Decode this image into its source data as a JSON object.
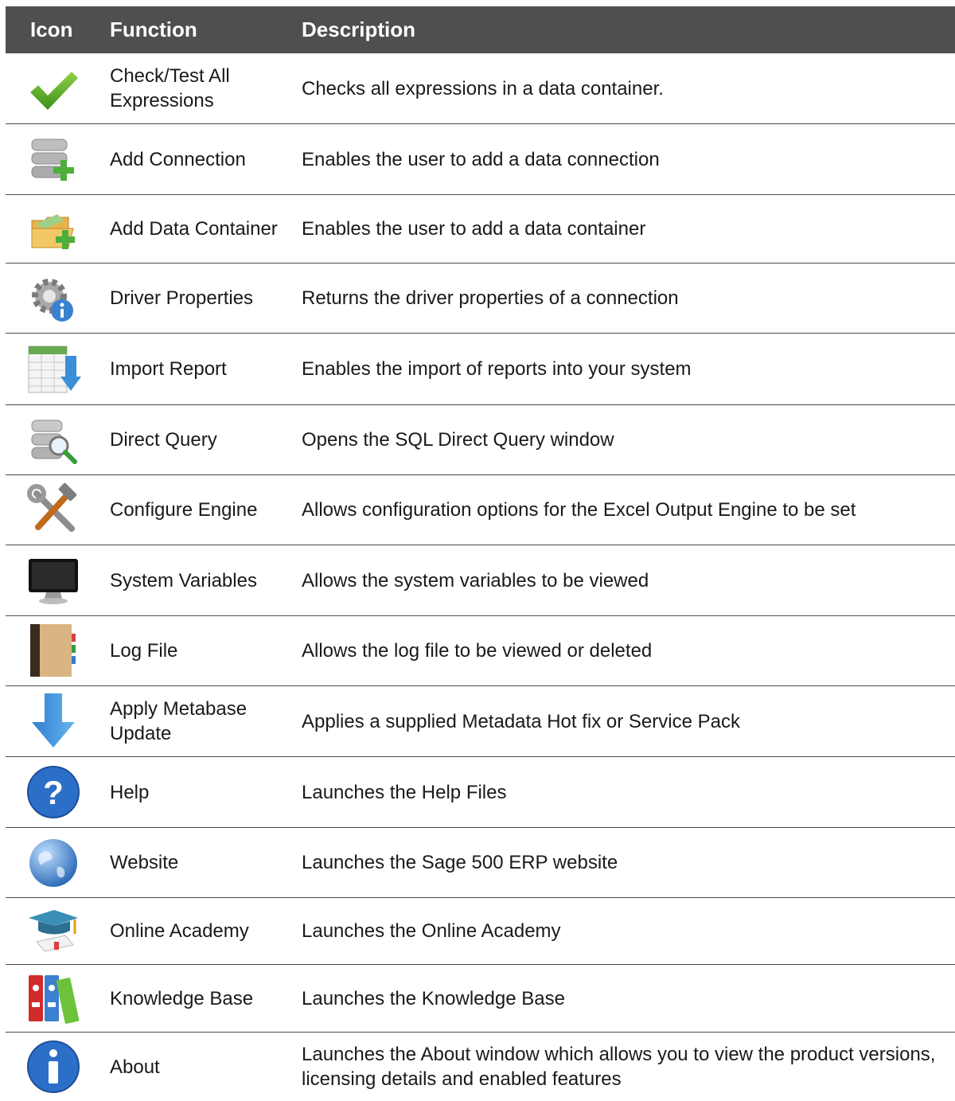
{
  "header": {
    "icon": "Icon",
    "function": "Function",
    "description": "Description"
  },
  "rows": [
    {
      "icon": "check-icon",
      "function": "Check/Test All Expressions",
      "description": "Checks all expressions in a data container."
    },
    {
      "icon": "add-connection-icon",
      "function": "Add Connection",
      "description": "Enables the user to add a data connection"
    },
    {
      "icon": "add-folder-icon",
      "function": "Add Data Container",
      "description": "Enables the user to add a data container"
    },
    {
      "icon": "gear-info-icon",
      "function": "Driver Properties",
      "description": "Returns the driver properties of a connection"
    },
    {
      "icon": "import-report-icon",
      "function": "Import Report",
      "description": "Enables the import of reports into your system"
    },
    {
      "icon": "database-search-icon",
      "function": "Direct Query",
      "description": "Opens the SQL Direct Query window"
    },
    {
      "icon": "tools-icon",
      "function": "Configure Engine",
      "description": "Allows configuration options for the Excel Output Engine to be set"
    },
    {
      "icon": "monitor-icon",
      "function": "System Variables",
      "description": "Allows the system variables to be viewed"
    },
    {
      "icon": "log-book-icon",
      "function": "Log File",
      "description": "Allows the log file to be viewed or deleted"
    },
    {
      "icon": "down-arrow-icon",
      "function": "Apply Metabase Update",
      "description": "Applies a supplied Metadata Hot fix or Service Pack"
    },
    {
      "icon": "help-icon",
      "function": "Help",
      "description": "Launches the Help Files"
    },
    {
      "icon": "globe-icon",
      "function": "Website",
      "description": "Launches the Sage 500 ERP website"
    },
    {
      "icon": "graduation-cap-icon",
      "function": "Online Academy",
      "description": "Launches the Online Academy"
    },
    {
      "icon": "binders-icon",
      "function": "Knowledge Base",
      "description": "Launches the Knowledge Base"
    },
    {
      "icon": "info-icon",
      "function": "About",
      "description": "Launches the About window which allows you to view the product versions, licensing details and enabled features"
    }
  ]
}
